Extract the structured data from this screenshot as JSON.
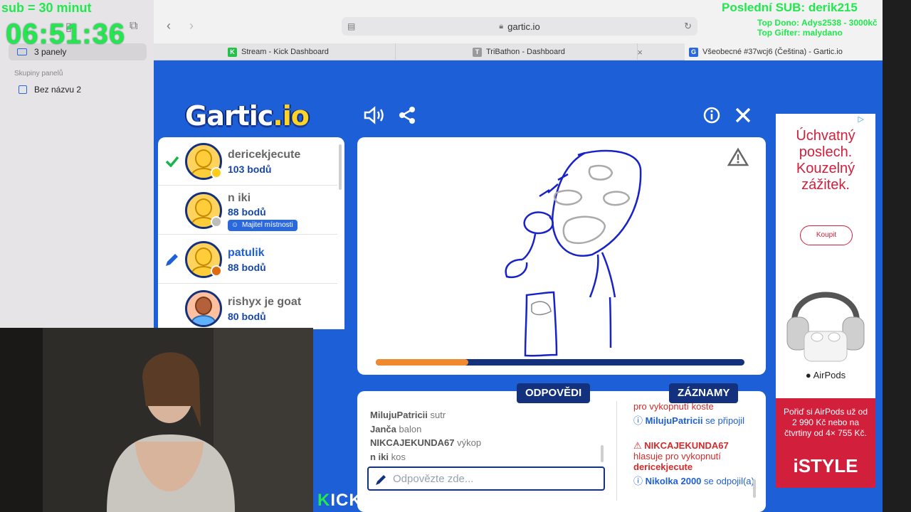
{
  "browser": {
    "sidebar": {
      "panels_label": "3 panely",
      "groups_title": "Skupiny panelů",
      "group_item": "Bez názvu 2"
    },
    "address": "gartic.io",
    "tabs": [
      {
        "label": "Stream - Kick Dashboard",
        "favicon_color": "#22c24a",
        "favicon_letter": "K"
      },
      {
        "label": "TriBathon - Dashboard",
        "favicon_color": "#9a9a9a",
        "favicon_letter": "T"
      },
      {
        "label": "Všeobecné #37wcj6 (Čeština) - Gartic.io",
        "favicon_color": "#2a68e0",
        "favicon_letter": "G"
      }
    ]
  },
  "game": {
    "logo_main": "Gartic",
    "logo_suffix": ".io",
    "players": [
      {
        "name": "dericekjecute",
        "points": "103 bodů",
        "status": "guessed",
        "dot_color": "#ffcc1c"
      },
      {
        "name": "n iki",
        "points": "88 bodů",
        "owner_badge": "Majitel místnosti",
        "dot_color": "#bdbdbd"
      },
      {
        "name": "patulik",
        "points": "88 bodů",
        "status": "drawing",
        "dot_color": "#e06a10",
        "name_color": "#1d5fd6"
      },
      {
        "name": "rishyx je goat",
        "points": "80 bodů"
      }
    ],
    "progress_fraction": 0.25,
    "tabs": {
      "answers": "ODPOVĚDI",
      "records": "ZÁZNAMY"
    },
    "answers": [
      {
        "user": "MilujuPatricii",
        "text": "sutr"
      },
      {
        "user": "Janča",
        "text": "balon"
      },
      {
        "user": "NIKCAJEKUNDA67",
        "text": "výkop"
      },
      {
        "user": "n iki",
        "text": "kos"
      }
    ],
    "answer_placeholder": "Odpovězte zde...",
    "records": {
      "line1": "pro vykopnutí koste",
      "line2_user": "MilujuPatricii",
      "line2_text": "se připojil",
      "line3_user": "NIKCAJEKUNDA67",
      "line3_text": "hlasuje pro vykopnutí",
      "line3_target": "dericekjecute",
      "line4_user": "Nikolka 2000",
      "line4_text": "se odpojil(a)"
    }
  },
  "ad": {
    "headline": "Úchvatný poslech. Kouzelný zážitek.",
    "button": "Koupit",
    "product": "AirPods",
    "offer": "Pořiď si AirPods už od 2 990 Kč nebo na čtvrtiny od 4× 755 Kč.",
    "store": "iSTYLE",
    "choices_mark": "▷"
  },
  "overlay": {
    "sub_text": "sub = 30 minut",
    "timer": "06:51:36",
    "last_sub": "Poslední SUB: derik215",
    "top_dono": "Top Dono: Adys2538 - 3000kč",
    "top_gifter": "Top Gifter: malydano",
    "kick_prefix": "K",
    "kick_url": "ICK.COM/PODDAMEBOZKOV"
  }
}
